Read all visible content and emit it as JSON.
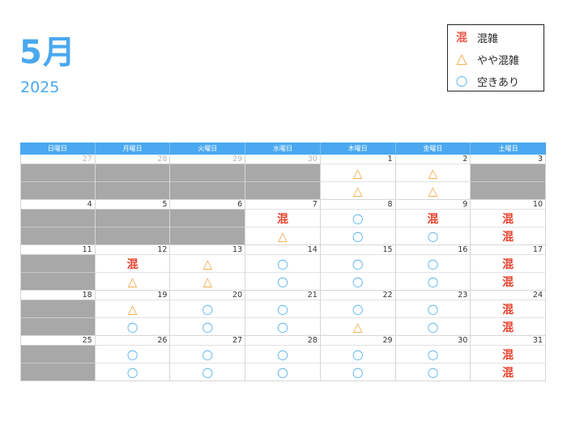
{
  "title": {
    "month": "5月",
    "year": "2025"
  },
  "legend": {
    "items": [
      {
        "symbol": "混",
        "label": "混雑",
        "kind": "busy"
      },
      {
        "symbol": "△",
        "label": "やや混雑",
        "kind": "tri"
      },
      {
        "symbol": "○",
        "label": "空きあり",
        "kind": "circ"
      }
    ]
  },
  "colors": {
    "accent": "#4aa8f0",
    "busy": "#e8442f",
    "partial": "#f3a43b",
    "open": "#5ab4f0",
    "closed": "#a8a8a8"
  },
  "weekdays": [
    "日曜日",
    "月曜日",
    "火曜日",
    "水曜日",
    "木曜日",
    "金曜日",
    "土曜日"
  ],
  "weeks": [
    [
      {
        "day": "27",
        "other": true,
        "slots": [
          "closed",
          "closed"
        ]
      },
      {
        "day": "28",
        "other": true,
        "slots": [
          "closed",
          "closed"
        ]
      },
      {
        "day": "29",
        "other": true,
        "slots": [
          "closed",
          "closed"
        ]
      },
      {
        "day": "30",
        "other": true,
        "slots": [
          "closed",
          "closed"
        ]
      },
      {
        "day": "1",
        "other": false,
        "slots": [
          "△",
          "△"
        ]
      },
      {
        "day": "2",
        "other": false,
        "slots": [
          "△",
          "△"
        ]
      },
      {
        "day": "3",
        "other": false,
        "slots": [
          "closed",
          "closed"
        ]
      }
    ],
    [
      {
        "day": "4",
        "other": false,
        "slots": [
          "closed",
          "closed"
        ]
      },
      {
        "day": "5",
        "other": false,
        "slots": [
          "closed",
          "closed"
        ]
      },
      {
        "day": "6",
        "other": false,
        "slots": [
          "closed",
          "closed"
        ]
      },
      {
        "day": "7",
        "other": false,
        "slots": [
          "混",
          "△"
        ]
      },
      {
        "day": "8",
        "other": false,
        "slots": [
          "○",
          "○"
        ]
      },
      {
        "day": "9",
        "other": false,
        "slots": [
          "混",
          "○"
        ]
      },
      {
        "day": "10",
        "other": false,
        "slots": [
          "混",
          "混"
        ]
      }
    ],
    [
      {
        "day": "11",
        "other": false,
        "slots": [
          "closed",
          "closed"
        ]
      },
      {
        "day": "12",
        "other": false,
        "slots": [
          "混",
          "△"
        ]
      },
      {
        "day": "13",
        "other": false,
        "slots": [
          "△",
          "△"
        ]
      },
      {
        "day": "14",
        "other": false,
        "slots": [
          "○",
          "○"
        ]
      },
      {
        "day": "15",
        "other": false,
        "slots": [
          "○",
          "○"
        ]
      },
      {
        "day": "16",
        "other": false,
        "slots": [
          "○",
          "○"
        ]
      },
      {
        "day": "17",
        "other": false,
        "slots": [
          "混",
          "混"
        ]
      }
    ],
    [
      {
        "day": "18",
        "other": false,
        "slots": [
          "closed",
          "closed"
        ]
      },
      {
        "day": "19",
        "other": false,
        "slots": [
          "△",
          "○"
        ]
      },
      {
        "day": "20",
        "other": false,
        "slots": [
          "○",
          "○"
        ]
      },
      {
        "day": "21",
        "other": false,
        "slots": [
          "○",
          "○"
        ]
      },
      {
        "day": "22",
        "other": false,
        "slots": [
          "○",
          "△"
        ]
      },
      {
        "day": "23",
        "other": false,
        "slots": [
          "○",
          "○"
        ]
      },
      {
        "day": "24",
        "other": false,
        "slots": [
          "混",
          "混"
        ]
      }
    ],
    [
      {
        "day": "25",
        "other": false,
        "slots": [
          "closed",
          "closed"
        ]
      },
      {
        "day": "26",
        "other": false,
        "slots": [
          "○",
          "○"
        ]
      },
      {
        "day": "27",
        "other": false,
        "slots": [
          "○",
          "○"
        ]
      },
      {
        "day": "28",
        "other": false,
        "slots": [
          "○",
          "○"
        ]
      },
      {
        "day": "29",
        "other": false,
        "slots": [
          "○",
          "○"
        ]
      },
      {
        "day": "30",
        "other": false,
        "slots": [
          "○",
          "○"
        ]
      },
      {
        "day": "31",
        "other": false,
        "slots": [
          "混",
          "混"
        ]
      }
    ]
  ]
}
